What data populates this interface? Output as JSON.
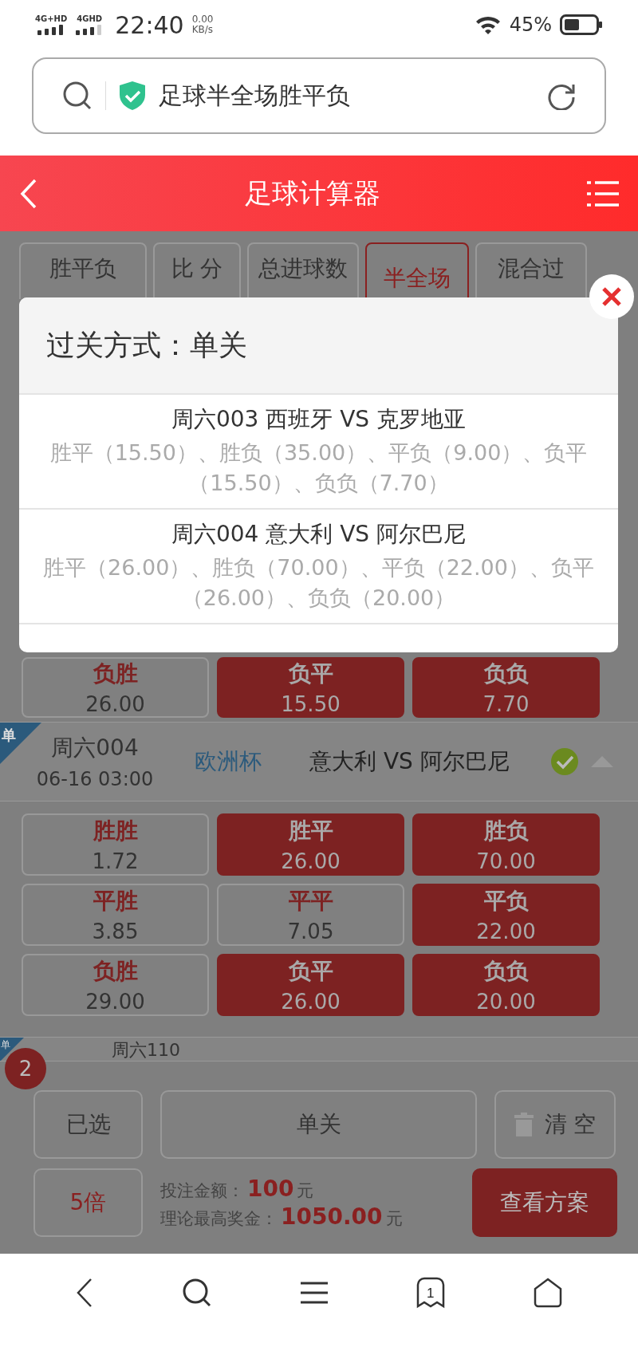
{
  "status_bar": {
    "network_1": "4G+HD",
    "network_2": "4GHD",
    "time": "22:40",
    "speed": "0.00",
    "speed_unit": "KB/s",
    "battery": "45%"
  },
  "address_bar": {
    "text": "足球半全场胜平负"
  },
  "header": {
    "title": "足球计算器"
  },
  "tabs": [
    {
      "label": "胜平负",
      "selected": false
    },
    {
      "label": "比 分",
      "selected": false
    },
    {
      "label": "总进球数",
      "selected": false
    },
    {
      "label": "半全场",
      "selected": true
    },
    {
      "label": "混合过",
      "selected": false
    }
  ],
  "dialog": {
    "title": "过关方式：单关",
    "items": [
      {
        "match": "周六003 西班牙 VS 克罗地亚",
        "selections": "胜平（15.50）、胜负（35.00）、平负（9.00）、负平（15.50）、负负（7.70）"
      },
      {
        "match": "周六004 意大利 VS 阿尔巴尼",
        "selections": "胜平（26.00）、胜负（70.00）、平负（22.00）、负平（26.00）、负负（20.00）"
      }
    ]
  },
  "previous_row": [
    {
      "label": "负胜",
      "odds": "26.00",
      "selected": false
    },
    {
      "label": "负平",
      "odds": "15.50",
      "selected": true
    },
    {
      "label": "负负",
      "odds": "7.70",
      "selected": true
    }
  ],
  "match": {
    "badge": "单",
    "number": "周六004",
    "time": "06-16 03:00",
    "league": "欧洲杯",
    "teams": "意大利 VS 阿尔巴尼",
    "checked": true,
    "options": [
      {
        "label": "胜胜",
        "odds": "1.72",
        "selected": false
      },
      {
        "label": "胜平",
        "odds": "26.00",
        "selected": true
      },
      {
        "label": "胜负",
        "odds": "70.00",
        "selected": true
      },
      {
        "label": "平胜",
        "odds": "3.85",
        "selected": false
      },
      {
        "label": "平平",
        "odds": "7.05",
        "selected": false
      },
      {
        "label": "平负",
        "odds": "22.00",
        "selected": true
      },
      {
        "label": "负胜",
        "odds": "29.00",
        "selected": false
      },
      {
        "label": "负平",
        "odds": "26.00",
        "selected": true
      },
      {
        "label": "负负",
        "odds": "20.00",
        "selected": true
      }
    ]
  },
  "next_match": {
    "badge": "单",
    "number": "周六110"
  },
  "footer": {
    "count": "2",
    "selected_label": "已选",
    "pass_mode": "单关",
    "clear": "清 空",
    "multiple": "5倍",
    "stake_label": "投注金额：",
    "stake": "100",
    "stake_unit": "元",
    "max_prize_label": "理论最高奖金：",
    "max_prize": "1050.00",
    "max_prize_unit": "元",
    "submit": "查看方案"
  },
  "browser_nav": {
    "tab_count": "1"
  }
}
